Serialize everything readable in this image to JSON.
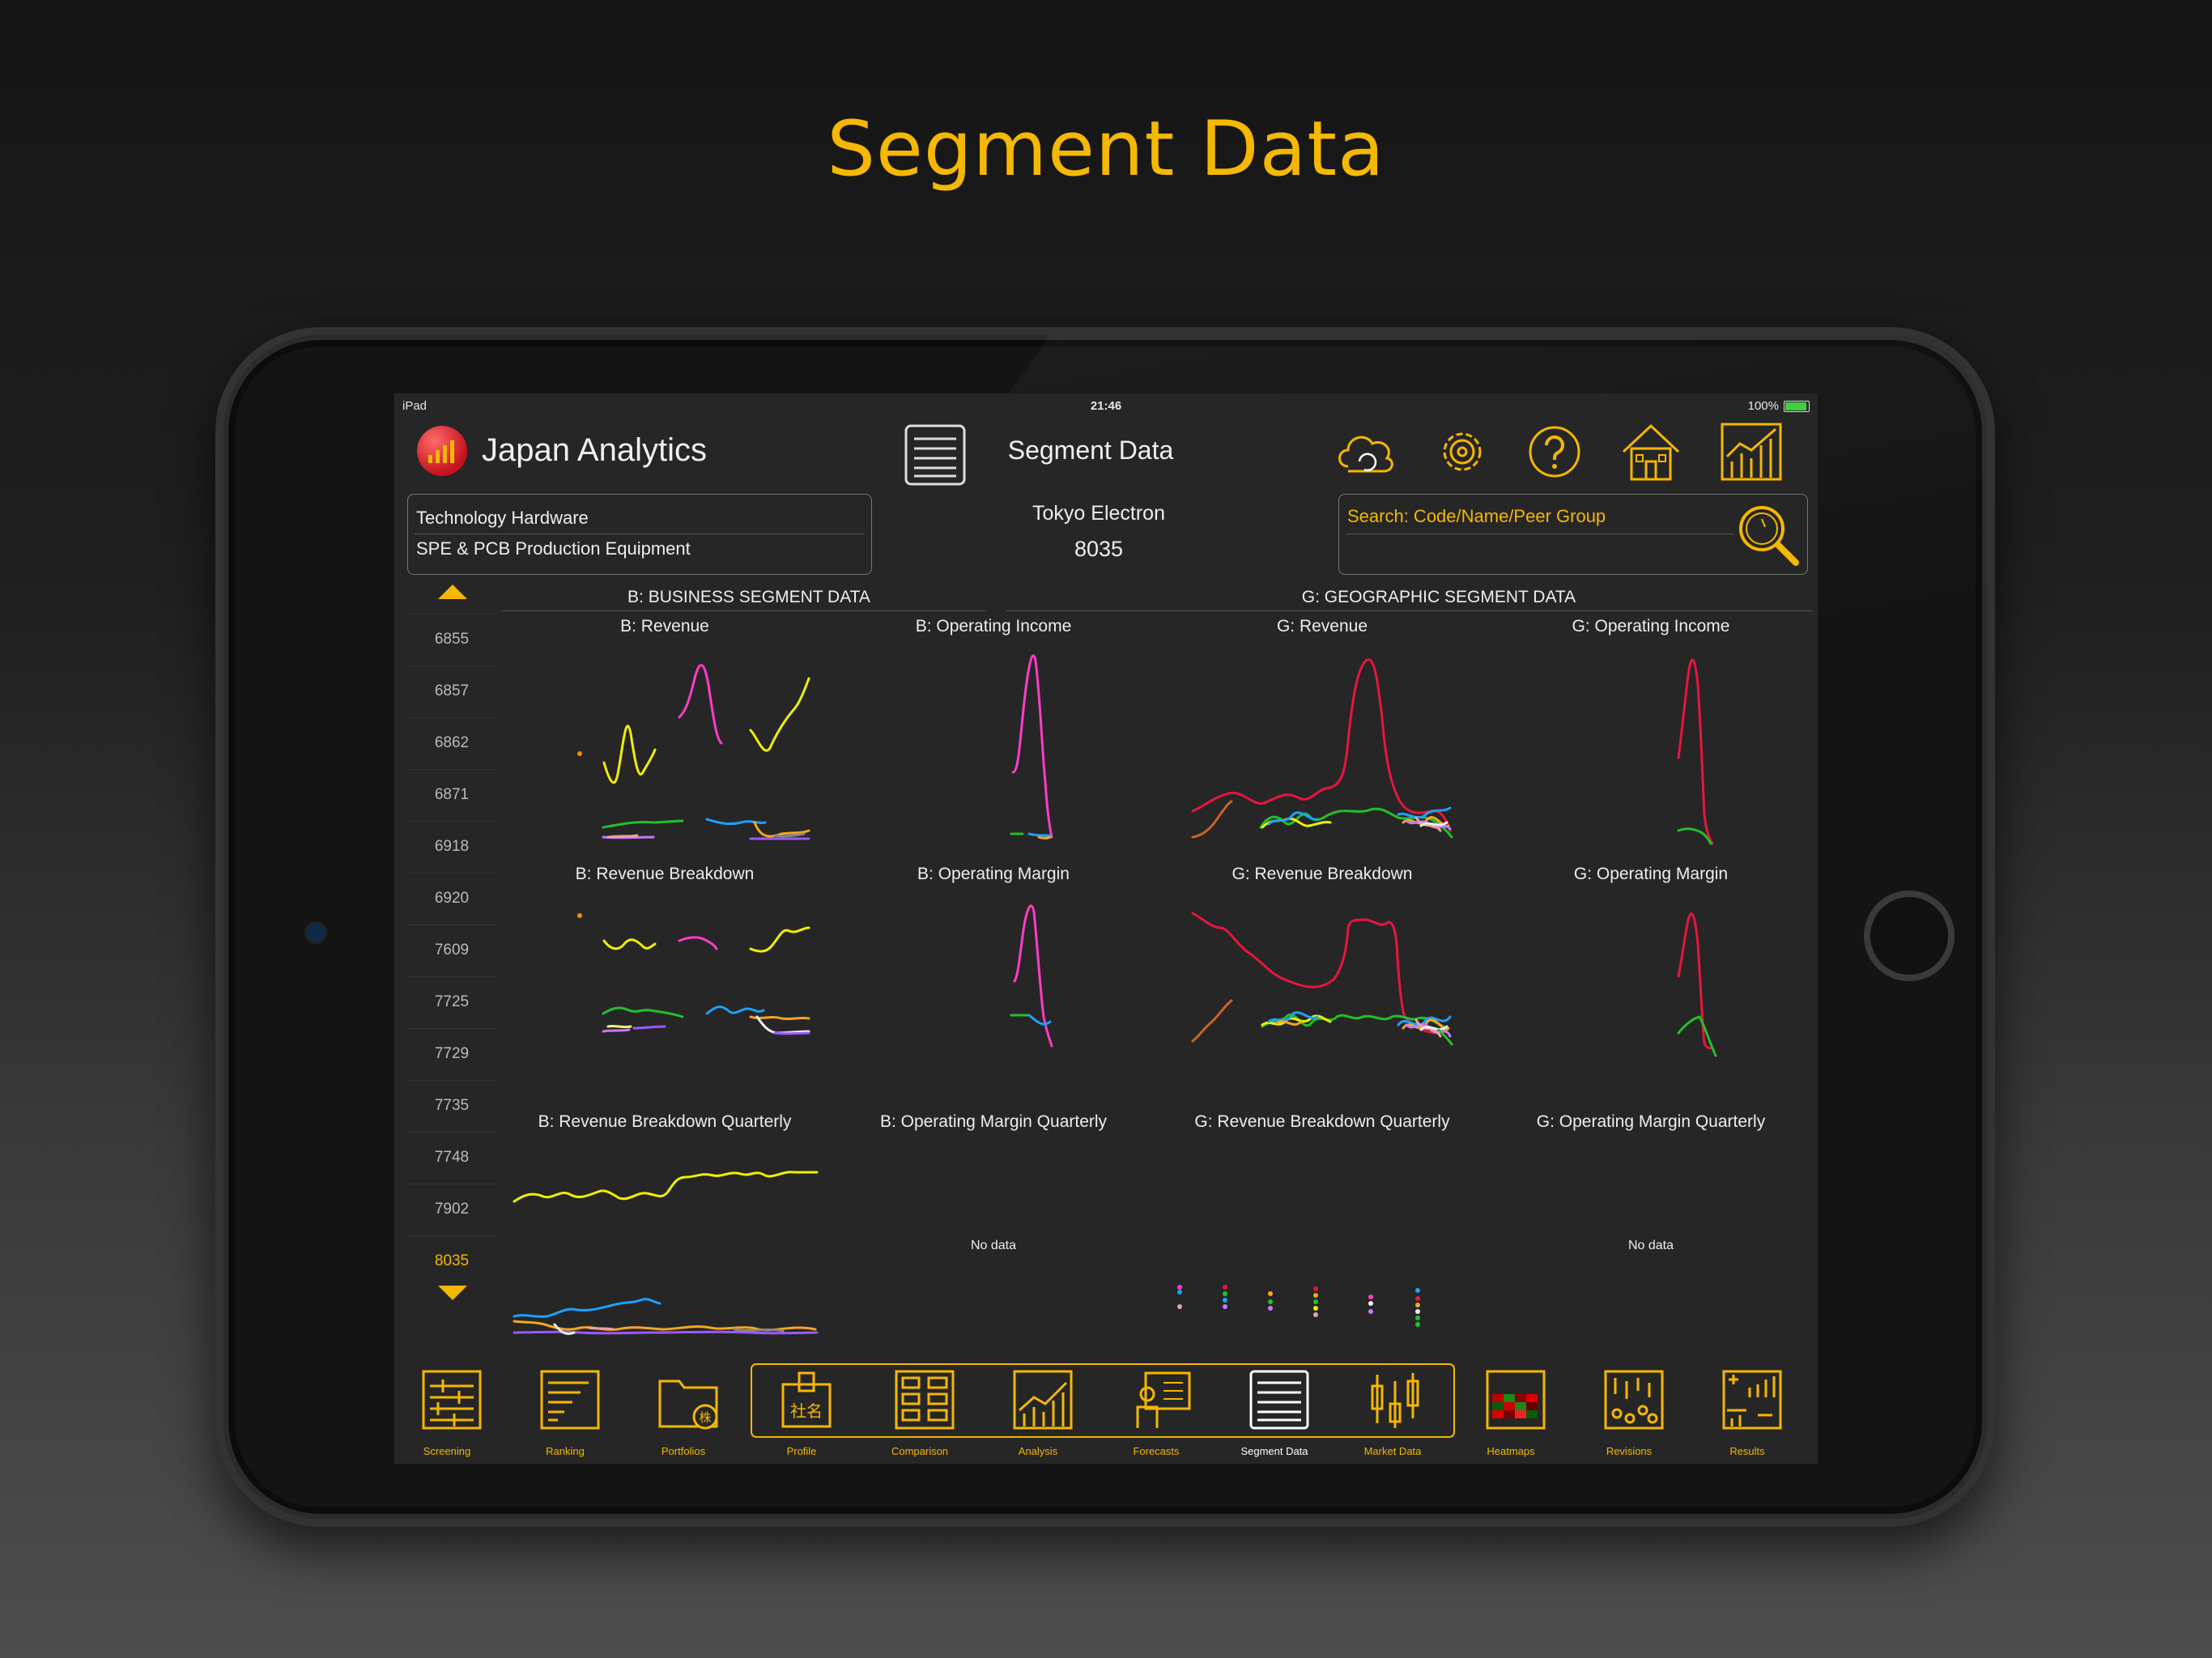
{
  "headline": "Segment Data",
  "status": {
    "device": "iPad",
    "time": "21:46",
    "battery": "100%"
  },
  "header": {
    "app_name": "Japan Analytics",
    "screen_title": "Segment Data"
  },
  "sector": {
    "line1": "Technology Hardware",
    "line2": "SPE & PCB Production Equipment"
  },
  "company": {
    "name": "Tokyo Electron",
    "code": "8035"
  },
  "search": {
    "placeholder": "Search: Code/Name/Peer Group"
  },
  "sidebar": {
    "codes": [
      "6855",
      "6857",
      "6862",
      "6871",
      "6918",
      "6920",
      "7609",
      "7725",
      "7729",
      "7735",
      "7748",
      "7902",
      "8035"
    ],
    "active": "8035"
  },
  "sections": {
    "business": "B: BUSINESS SEGMENT DATA",
    "geographic": "G: GEOGRAPHIC SEGMENT DATA"
  },
  "charts": {
    "b_revenue": "B: Revenue",
    "b_op_income": "B: Operating Income",
    "g_revenue": "G: Revenue",
    "g_op_income": "G: Operating Income",
    "b_rev_breakdown": "B: Revenue Breakdown",
    "b_op_margin": "B: Operating Margin",
    "g_rev_breakdown": "G: Revenue Breakdown",
    "g_op_margin": "G: Operating Margin",
    "b_rev_breakdown_q": "B: Revenue Breakdown Quarterly",
    "b_op_margin_q": "B: Operating Margin Quarterly",
    "g_rev_breakdown_q": "G: Revenue Breakdown Quarterly",
    "g_op_margin_q": "G: Operating Margin Quarterly",
    "no_data": "No data"
  },
  "tabs": [
    {
      "label": "Screening",
      "icon": "screening-icon"
    },
    {
      "label": "Ranking",
      "icon": "ranking-icon"
    },
    {
      "label": "Portfolios",
      "icon": "portfolios-icon"
    },
    {
      "label": "Profile",
      "icon": "profile-icon"
    },
    {
      "label": "Comparison",
      "icon": "comparison-icon"
    },
    {
      "label": "Analysis",
      "icon": "analysis-icon"
    },
    {
      "label": "Forecasts",
      "icon": "forecasts-icon"
    },
    {
      "label": "Segment Data",
      "icon": "segment-data-icon"
    },
    {
      "label": "Market Data",
      "icon": "market-data-icon"
    },
    {
      "label": "Heatmaps",
      "icon": "heatmaps-icon"
    },
    {
      "label": "Revisions",
      "icon": "revisions-icon"
    },
    {
      "label": "Results",
      "icon": "results-icon"
    }
  ],
  "tab_glyphs": {
    "profile": "社名",
    "portfolios": "株"
  },
  "colors": {
    "accent": "#f5b800",
    "background": "#262626",
    "selected_tab": "#ffffff"
  }
}
